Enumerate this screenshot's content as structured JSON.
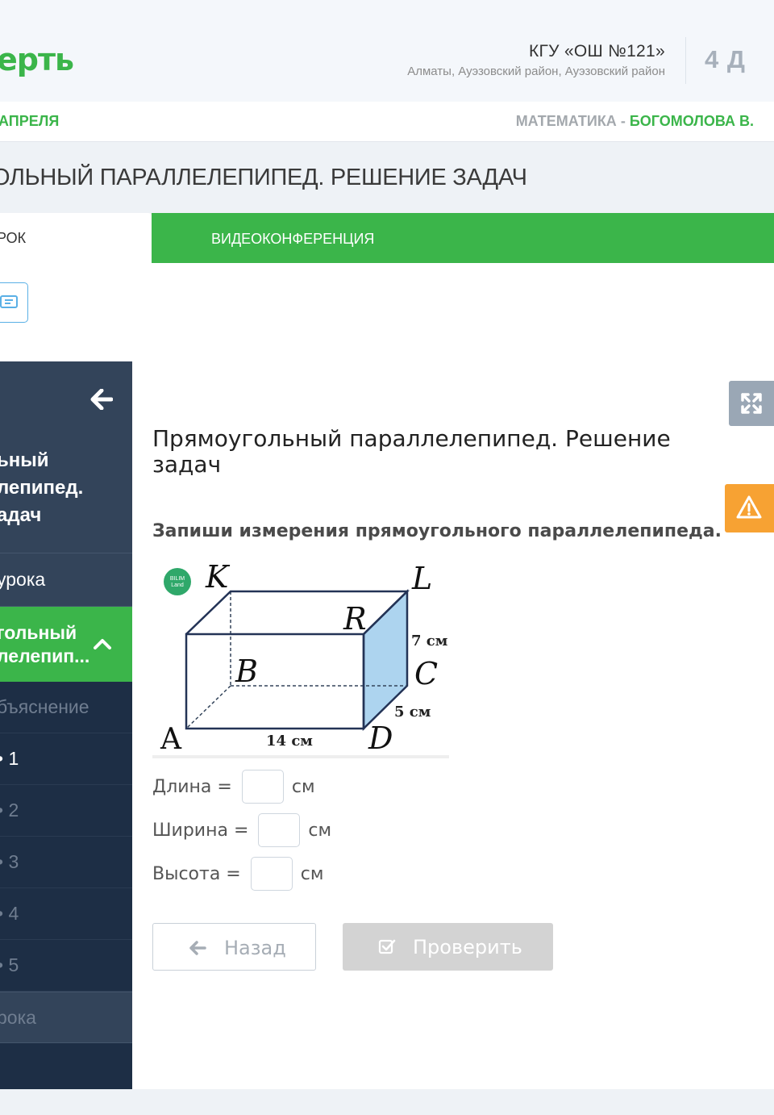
{
  "header": {
    "logo": "ерть",
    "school_name": "КГУ «ОШ №121»",
    "school_address": "Алматы, Ауэзовский район, Ауэзовский район",
    "grade": "4 Д"
  },
  "subbar": {
    "date": "АПРЕЛЯ",
    "subject": "МАТЕМАТИКА",
    "separator": " - ",
    "teacher": "БОГОМОЛОВА В."
  },
  "lesson_title": "ОЛЬНЫЙ ПАРАЛЛЕЛЕПИПЕД. РЕШЕНИЕ ЗАДАЧ",
  "tabs": {
    "lesson": "РОК",
    "video": "ВИДЕОКОНФЕРЕНЦИЯ"
  },
  "sidebar": {
    "title": "ьный лепипед. адач",
    "aim": "урока",
    "active_item": "гольный лелепип...",
    "explanation": "бъяснение",
    "tasks": [
      "1",
      "2",
      "3",
      "4",
      "5"
    ],
    "end": "рока"
  },
  "main": {
    "title": "Прямоугольный параллелепипед. Решение задач",
    "task": "Запиши измерения прямоугольного параллелепипеда."
  },
  "figure": {
    "badge": "BILIM Land",
    "labels": {
      "K": "K",
      "L": "L",
      "R": "R",
      "B": "B",
      "C": "C",
      "A": "A",
      "D": "D",
      "height": "7 см",
      "width": "5 см",
      "length": "14 см"
    }
  },
  "fields": {
    "length_label": "Длина =",
    "width_label": "Ширина =",
    "height_label": "Высота =",
    "unit": "см",
    "length_value": "",
    "width_value": "",
    "height_value": ""
  },
  "buttons": {
    "back": "Назад",
    "check": "Проверить"
  },
  "colors": {
    "green": "#3bb54a",
    "sidebar": "#1d2e45",
    "warning": "#f7a233",
    "face_blue": "#add4ef"
  }
}
